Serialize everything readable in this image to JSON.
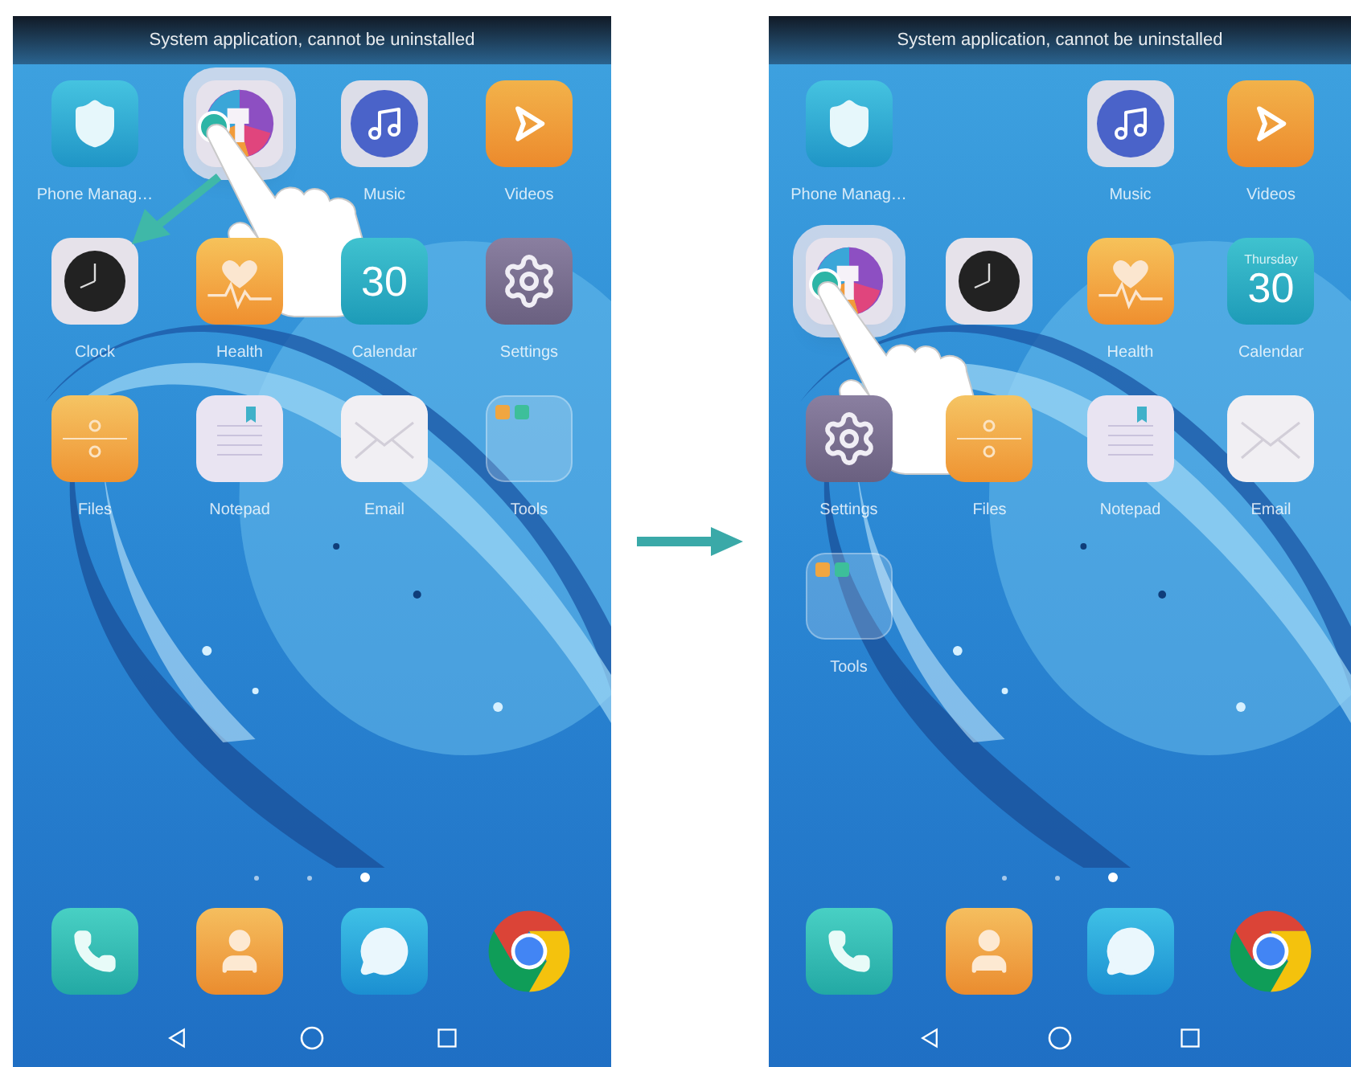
{
  "screens": [
    {
      "toast": "System application, cannot be uninstalled",
      "drag_arrow": true,
      "apps": [
        {
          "kind": "shield",
          "label": "Phone Manag…",
          "lifted": false
        },
        {
          "kind": "theme",
          "lifted": true,
          "touched": true
        },
        {
          "kind": "music",
          "label": "Music",
          "lifted": false
        },
        {
          "kind": "video",
          "label": "Videos",
          "lifted": false
        },
        {
          "kind": "clock",
          "label": "Clock",
          "lifted": false
        },
        {
          "kind": "health",
          "label": "Health",
          "lifted": false
        },
        {
          "kind": "calendar",
          "date": "30",
          "label": "Calendar",
          "lifted": false
        },
        {
          "kind": "settings",
          "label": "Settings",
          "lifted": false
        },
        {
          "kind": "files",
          "label": "Files",
          "lifted": false
        },
        {
          "kind": "notepad",
          "label": "Notepad",
          "lifted": false
        },
        {
          "kind": "email",
          "label": "Email",
          "lifted": false
        },
        {
          "kind": "folder",
          "label": "Tools",
          "lifted": false
        }
      ],
      "dots": [
        {
          "selected": false
        },
        {
          "selected": false
        },
        {
          "selected": true
        }
      ],
      "dock": [
        {
          "kind": "phone"
        },
        {
          "kind": "contacts"
        },
        {
          "kind": "messages"
        },
        {
          "kind": "browser"
        }
      ]
    },
    {
      "toast": "System application, cannot be uninstalled",
      "drag_arrow": false,
      "apps": [
        {
          "kind": "shield",
          "label": "Phone Manag…",
          "lifted": false
        },
        {
          "kind": "empty"
        },
        {
          "kind": "music",
          "label": "Music",
          "lifted": false
        },
        {
          "kind": "video",
          "label": "Videos",
          "lifted": false
        },
        {
          "kind": "theme",
          "lifted": true,
          "touched": true
        },
        {
          "kind": "clock",
          "lifted": false
        },
        {
          "kind": "health",
          "label": "Health",
          "lifted": false
        },
        {
          "kind": "calendar",
          "day": "Thursday",
          "date": "30",
          "label": "Calendar",
          "lifted": false
        },
        {
          "kind": "settings",
          "label": "Settings",
          "lifted": false
        },
        {
          "kind": "files",
          "label": "Files",
          "lifted": false
        },
        {
          "kind": "notepad",
          "label": "Notepad",
          "lifted": false
        },
        {
          "kind": "email",
          "label": "Email",
          "lifted": false
        },
        {
          "kind": "folder",
          "label": "Tools",
          "lifted": false
        }
      ],
      "dots": [
        {
          "selected": false
        },
        {
          "selected": false
        },
        {
          "selected": true
        }
      ],
      "dock": [
        {
          "kind": "phone"
        },
        {
          "kind": "contacts"
        },
        {
          "kind": "messages"
        },
        {
          "kind": "browser"
        }
      ]
    }
  ]
}
